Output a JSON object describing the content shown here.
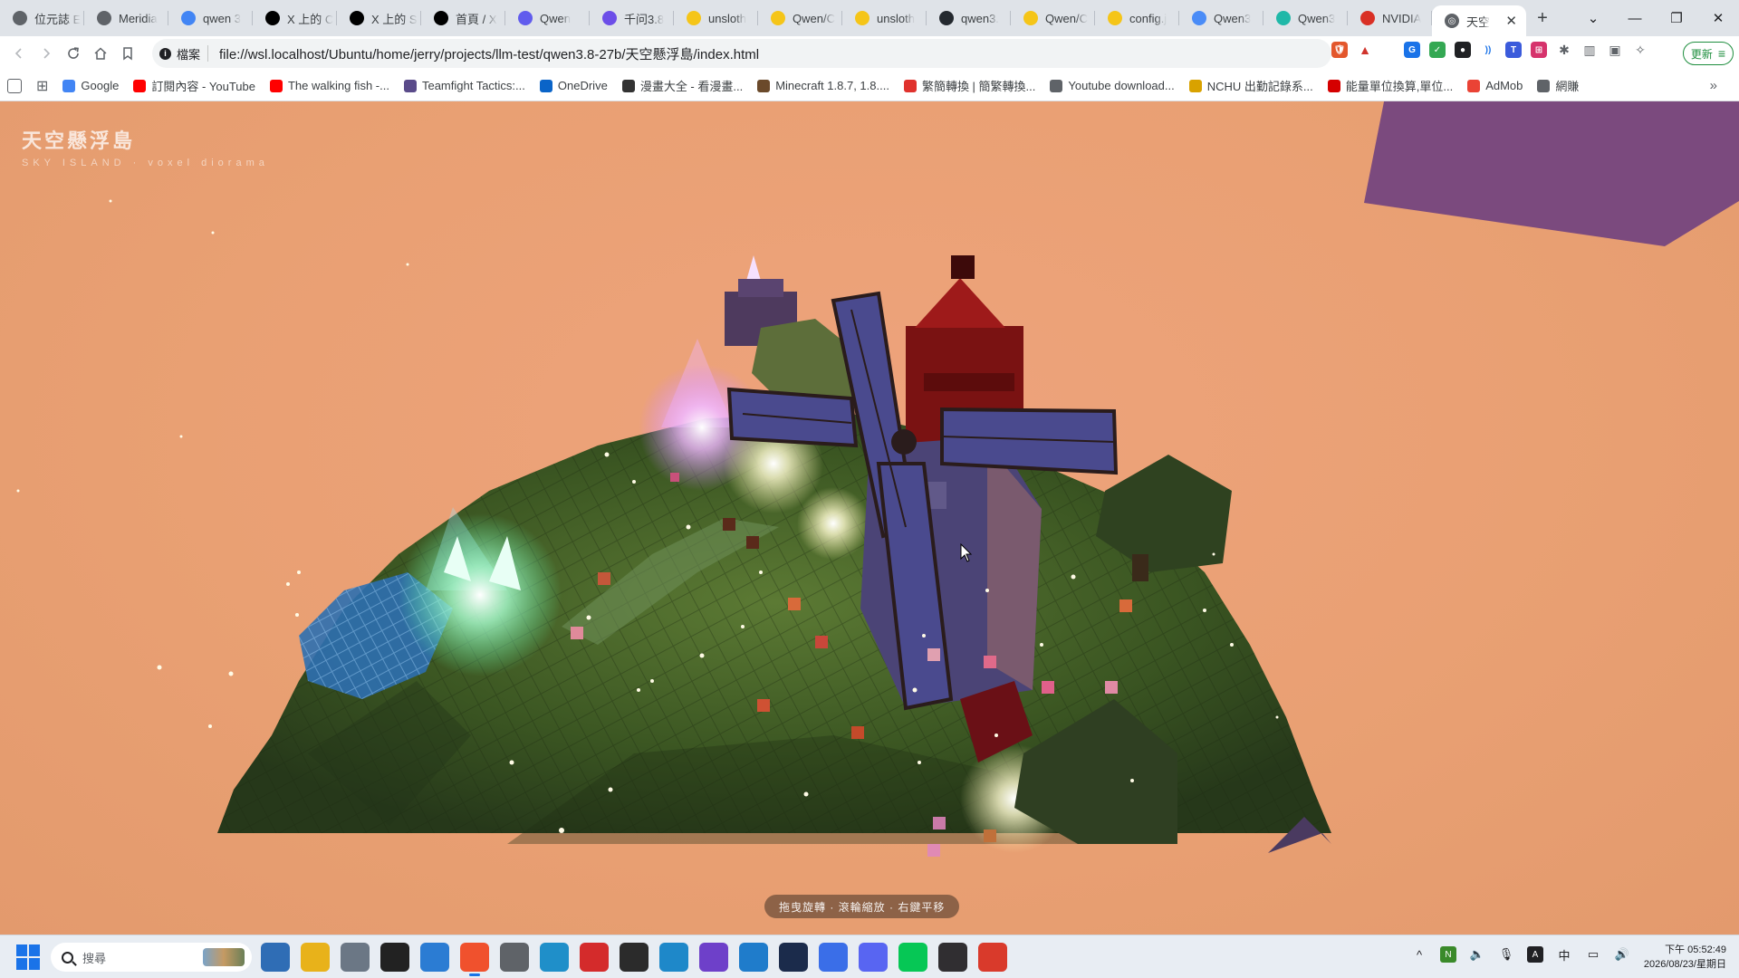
{
  "browser": {
    "tabs": [
      {
        "title": "位元誌 E",
        "icon": "globe-icon",
        "color": "#5f6368"
      },
      {
        "title": "Meridia",
        "icon": "globe-icon",
        "color": "#5f6368"
      },
      {
        "title": "qwen 3",
        "icon": "google-icon",
        "color": "#4285f4"
      },
      {
        "title": "X 上的 C",
        "icon": "x-icon",
        "color": "#000000"
      },
      {
        "title": "X 上的 S",
        "icon": "x-icon",
        "color": "#000000"
      },
      {
        "title": "首頁 / X",
        "icon": "x-icon",
        "color": "#000000"
      },
      {
        "title": "Qwen",
        "icon": "qwen-icon",
        "color": "#615ced"
      },
      {
        "title": "千问3.8",
        "icon": "qianwen-icon",
        "color": "#6c4ee8"
      },
      {
        "title": "unsloth",
        "icon": "huggingface-icon",
        "color": "#f5c518"
      },
      {
        "title": "Qwen/C",
        "icon": "huggingface-icon",
        "color": "#f5c518"
      },
      {
        "title": "unsloth",
        "icon": "huggingface-icon",
        "color": "#f5c518"
      },
      {
        "title": "qwen3.",
        "icon": "github-icon",
        "color": "#24292f"
      },
      {
        "title": "Qwen/C",
        "icon": "huggingface-icon",
        "color": "#f5c518"
      },
      {
        "title": "config.j",
        "icon": "huggingface-icon",
        "color": "#f5c518"
      },
      {
        "title": "Qwen3",
        "icon": "gemini-icon",
        "color": "#4a8cf7"
      },
      {
        "title": "Qwen3",
        "icon": "perplexity-icon",
        "color": "#20b8a8"
      },
      {
        "title": "NVIDIA",
        "icon": "nvidia-icon",
        "color": "#d93025"
      }
    ],
    "active_tab": {
      "title": "天空",
      "close": "✕"
    },
    "new_tab": "+",
    "window_controls": {
      "dropdown": "⌄",
      "minimize": "—",
      "restore": "❐",
      "close": "✕"
    },
    "address": {
      "scheme_label": "檔案",
      "url": "file://wsl.localhost/Ubuntu/home/jerry/projects/llm-test/qwen3.8-27b/天空懸浮島/index.html"
    },
    "update_button": "更新",
    "bookmarks": [
      {
        "label": "Google",
        "icon": "google-icon",
        "color": "#4285f4"
      },
      {
        "label": "訂閱內容 - YouTube",
        "icon": "youtube-icon",
        "color": "#ff0000"
      },
      {
        "label": "The walking fish -...",
        "icon": "youtube-icon",
        "color": "#ff0000"
      },
      {
        "label": "Teamfight Tactics:...",
        "icon": "tft-icon",
        "color": "#5a4b8a"
      },
      {
        "label": "OneDrive",
        "icon": "cloud-icon",
        "color": "#0a64c8"
      },
      {
        "label": "漫畫大全 - 看漫畫...",
        "icon": "manga-icon",
        "color": "#333333"
      },
      {
        "label": "Minecraft 1.8.7, 1.8....",
        "icon": "minecraft-icon",
        "color": "#6b4a2b"
      },
      {
        "label": "繁簡轉換 | 簡繁轉換...",
        "icon": "convert-icon",
        "color": "#e0322d"
      },
      {
        "label": "Youtube download...",
        "icon": "globe-icon",
        "color": "#5f6368"
      },
      {
        "label": "NCHU 出勤記錄系...",
        "icon": "nchu-icon",
        "color": "#d9a200"
      },
      {
        "label": "能量單位換算,單位...",
        "icon": "unit-icon",
        "color": "#d50000"
      },
      {
        "label": "AdMob",
        "icon": "admob-icon",
        "color": "#ea4335"
      },
      {
        "label": "網賺",
        "icon": "folder-icon",
        "color": "#5f6368"
      }
    ],
    "bookmarks_more": "»"
  },
  "app": {
    "title": "天空懸浮島",
    "subtitle": "SKY ISLAND · voxel diorama",
    "hint": "拖曳旋轉 · 滾輪縮放 · 右鍵平移"
  },
  "taskbar": {
    "search_placeholder": "搜尋",
    "apps": [
      {
        "name": "task-view",
        "color": "#2f6db5",
        "active": false
      },
      {
        "name": "file-explorer",
        "color": "#e8b21a",
        "active": false
      },
      {
        "name": "calculator",
        "color": "#6b7785",
        "active": false
      },
      {
        "name": "video-player",
        "color": "#222222",
        "active": false
      },
      {
        "name": "word-app",
        "color": "#2b7cd3",
        "active": false
      },
      {
        "name": "brave-browser",
        "color": "#f0512d",
        "active": true
      },
      {
        "name": "clock-app",
        "color": "#5f6368",
        "active": false
      },
      {
        "name": "photos-app",
        "color": "#1f8fc9",
        "active": false
      },
      {
        "name": "red-app",
        "color": "#d42b2b",
        "active": false
      },
      {
        "name": "terminal",
        "color": "#2b2b2b",
        "active": false
      },
      {
        "name": "edge-browser",
        "color": "#1e88c9",
        "active": false
      },
      {
        "name": "github-desktop",
        "color": "#6e40c9",
        "active": false
      },
      {
        "name": "vscode",
        "color": "#1f7ccb",
        "active": false
      },
      {
        "name": "text-editor",
        "color": "#1b2b4b",
        "active": false
      },
      {
        "name": "arc-app",
        "color": "#3a6ee8",
        "active": false
      },
      {
        "name": "discord",
        "color": "#5865f2",
        "active": false
      },
      {
        "name": "line",
        "color": "#06c755",
        "active": false
      },
      {
        "name": "obs-studio",
        "color": "#302e31",
        "active": false
      },
      {
        "name": "headset-app",
        "color": "#d93a2b",
        "active": false
      }
    ],
    "tray_chevron": "^",
    "time_prefix": "下午",
    "time": "05:52:49",
    "date": "2026/08/23/星期日"
  },
  "colors": {
    "sky": "#e9a073",
    "grass": "#3d5a24",
    "water": "#2e6fb0",
    "windmill_sail": "#4a4a8e",
    "roof": "#8a1414",
    "crystal": "#e6b3ff"
  }
}
